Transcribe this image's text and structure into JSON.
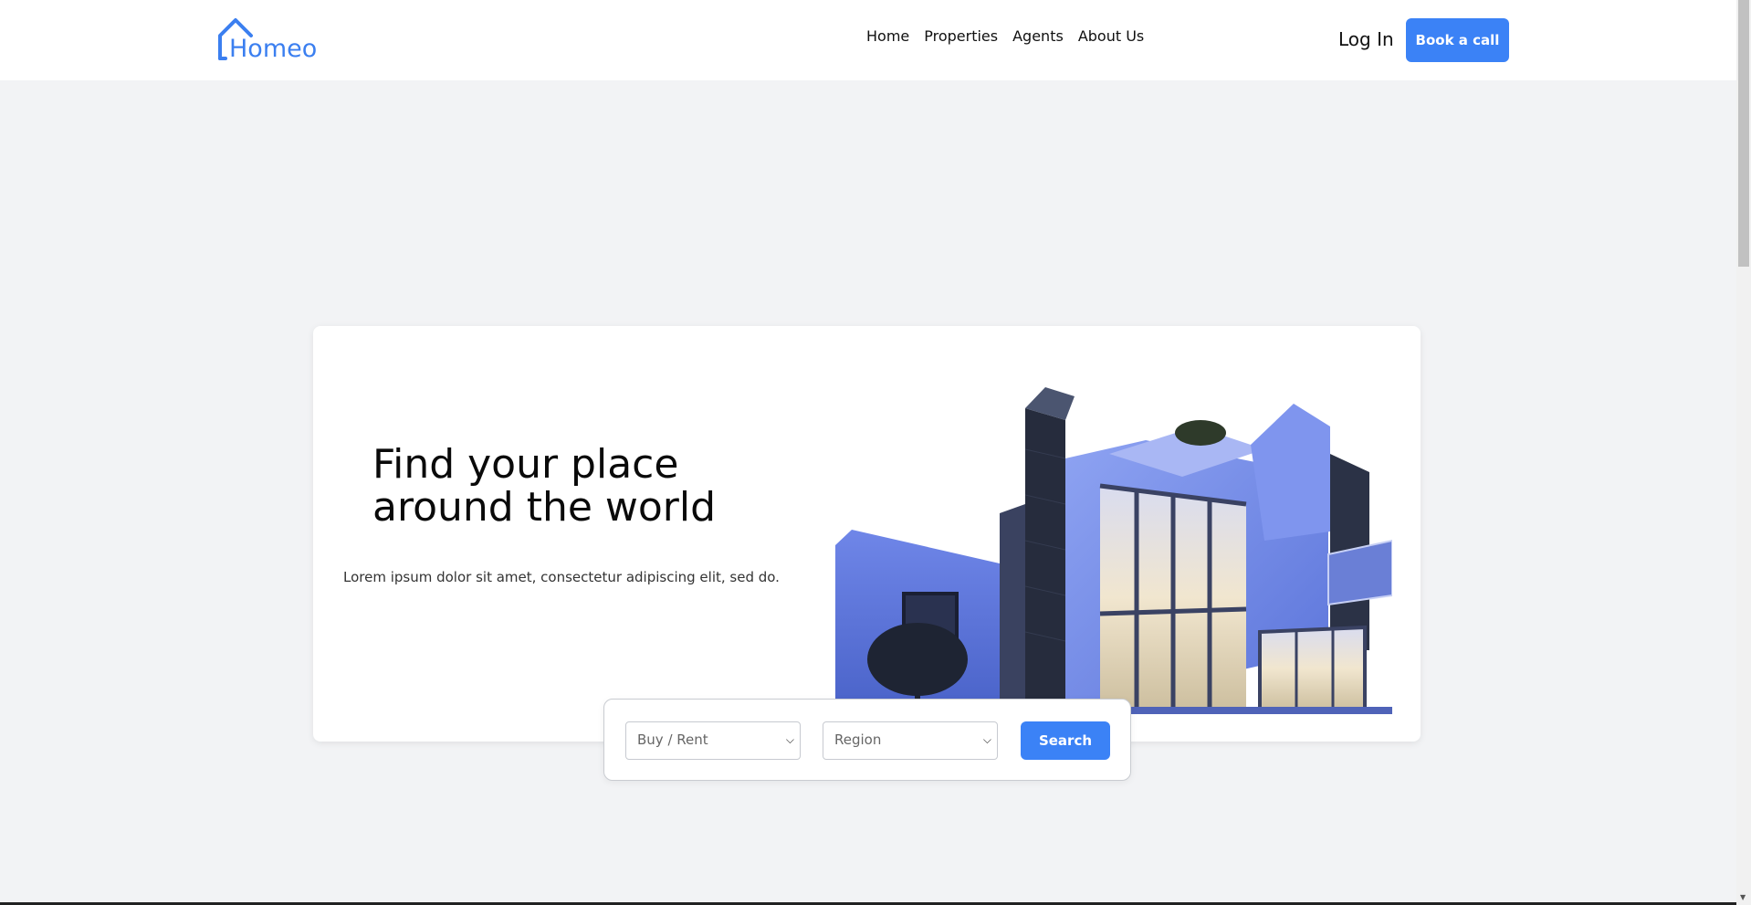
{
  "header": {
    "logo_text": "Homeo",
    "nav": [
      {
        "label": "Home"
      },
      {
        "label": "Properties"
      },
      {
        "label": "Agents"
      },
      {
        "label": "About Us"
      }
    ],
    "login_label": "Log In",
    "cta_label": "Book a call"
  },
  "hero": {
    "title_line1": "Find your place",
    "title_line2": "around the world",
    "subtitle": "Lorem ipsum dolor sit amet, consectetur adipiscing elit, sed do."
  },
  "search": {
    "type_select": "Buy / Rent",
    "region_select": "Region",
    "button_label": "Search"
  },
  "colors": {
    "accent": "#3b82f6",
    "background": "#f2f3f5",
    "card": "#ffffff"
  },
  "icons": {
    "logo": "house-outline-icon",
    "select_chevron": "chevron-down-icon"
  }
}
